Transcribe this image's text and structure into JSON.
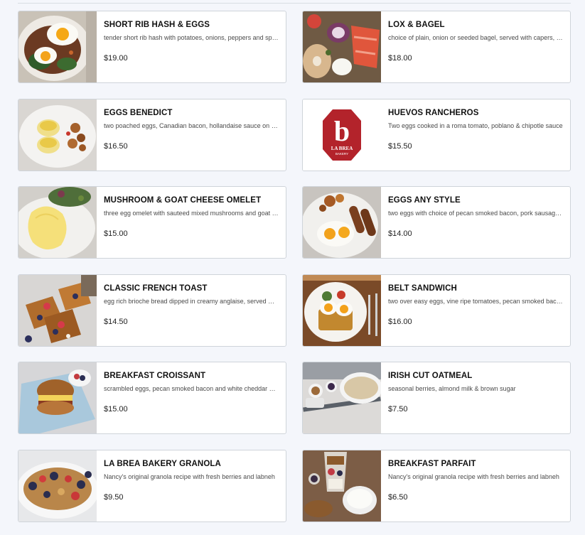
{
  "menu": {
    "items": [
      {
        "name": "SHORT RIB HASH & EGGS",
        "description": "tender short rib hash with potatoes, onions, peppers and spinach, topped with two sunny side up eggs",
        "price": "$19.00",
        "image": "short-rib-hash-photo"
      },
      {
        "name": "LOX & BAGEL",
        "description": "choice of plain, onion or seeded bagel, served with capers, red onion, tomato and cream cheese",
        "price": "$18.00",
        "image": "lox-bagel-photo"
      },
      {
        "name": "EGGS BENEDICT",
        "description": "two poached eggs, Canadian bacon, hollandaise sauce on an english muffin",
        "price": "$16.50",
        "image": "eggs-benedict-photo"
      },
      {
        "name": "HUEVOS RANCHEROS",
        "description": "Two eggs cooked in a roma tomato, poblano & chipotle sauce",
        "price": "$15.50",
        "image": "la-brea-bakery-logo"
      },
      {
        "name": "MUSHROOM & GOAT CHEESE OMELET",
        "description": "three egg omelet with sauteed mixed mushrooms and goat cheese",
        "price": "$15.00",
        "image": "omelet-photo"
      },
      {
        "name": "EGGS ANY STYLE",
        "description": "two eggs with choice of pecan smoked bacon, pork sausage or chicken sausage",
        "price": "$14.00",
        "image": "eggs-any-style-photo"
      },
      {
        "name": "CLASSIC FRENCH TOAST",
        "description": "egg rich brioche bread dipped in creamy anglaise, served with berries",
        "price": "$14.50",
        "image": "french-toast-photo"
      },
      {
        "name": "BELT SANDWICH",
        "description": "two over easy eggs, vine ripe tomatoes, pecan smoked bacon, lettuce",
        "price": "$16.00",
        "image": "belt-sandwich-photo"
      },
      {
        "name": "BREAKFAST CROISSANT",
        "description": "scrambled eggs, pecan smoked bacon and white cheddar cheese",
        "price": "$15.00",
        "image": "croissant-photo"
      },
      {
        "name": "IRISH CUT OATMEAL",
        "description": "seasonal berries, almond milk & brown sugar",
        "price": "$7.50",
        "image": "oatmeal-photo"
      },
      {
        "name": "LA BREA BAKERY GRANOLA",
        "description": "Nancy's original granola recipe with fresh berries and labneh",
        "price": "$9.50",
        "image": "granola-photo"
      },
      {
        "name": "BREAKFAST PARFAIT",
        "description": "Nancy's original granola recipe with fresh berries and labneh",
        "price": "$6.50",
        "image": "parfait-photo"
      }
    ]
  },
  "logo": {
    "brand_text": "LA BREA BAKERY",
    "letter": "b",
    "color": "#b3232b"
  },
  "colors": {
    "background": "#f4f6fb",
    "card_border": "#cfd4da"
  }
}
